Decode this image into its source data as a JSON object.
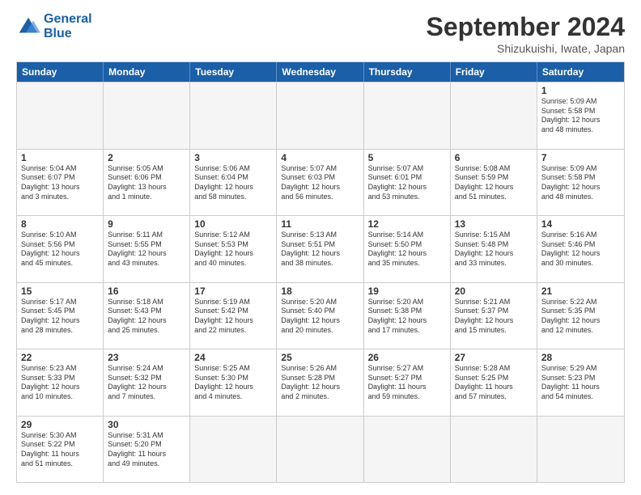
{
  "header": {
    "logo": {
      "line1": "General",
      "line2": "Blue"
    },
    "title": "September 2024",
    "location": "Shizukuishi, Iwate, Japan"
  },
  "weekdays": [
    "Sunday",
    "Monday",
    "Tuesday",
    "Wednesday",
    "Thursday",
    "Friday",
    "Saturday"
  ],
  "rows": [
    [
      {
        "day": "",
        "empty": true
      },
      {
        "day": "",
        "empty": true
      },
      {
        "day": "",
        "empty": true
      },
      {
        "day": "",
        "empty": true
      },
      {
        "day": "",
        "empty": true
      },
      {
        "day": "",
        "empty": true
      },
      {
        "day": "1",
        "lines": [
          "Sunrise: 5:09 AM",
          "Sunset: 5:58 PM",
          "Daylight: 12 hours",
          "and 48 minutes."
        ]
      }
    ],
    [
      {
        "day": "1",
        "lines": [
          "Sunrise: 5:04 AM",
          "Sunset: 6:07 PM",
          "Daylight: 13 hours",
          "and 3 minutes."
        ]
      },
      {
        "day": "2",
        "lines": [
          "Sunrise: 5:05 AM",
          "Sunset: 6:06 PM",
          "Daylight: 13 hours",
          "and 1 minute."
        ]
      },
      {
        "day": "3",
        "lines": [
          "Sunrise: 5:06 AM",
          "Sunset: 6:04 PM",
          "Daylight: 12 hours",
          "and 58 minutes."
        ]
      },
      {
        "day": "4",
        "lines": [
          "Sunrise: 5:07 AM",
          "Sunset: 6:03 PM",
          "Daylight: 12 hours",
          "and 56 minutes."
        ]
      },
      {
        "day": "5",
        "lines": [
          "Sunrise: 5:07 AM",
          "Sunset: 6:01 PM",
          "Daylight: 12 hours",
          "and 53 minutes."
        ]
      },
      {
        "day": "6",
        "lines": [
          "Sunrise: 5:08 AM",
          "Sunset: 5:59 PM",
          "Daylight: 12 hours",
          "and 51 minutes."
        ]
      },
      {
        "day": "7",
        "lines": [
          "Sunrise: 5:09 AM",
          "Sunset: 5:58 PM",
          "Daylight: 12 hours",
          "and 48 minutes."
        ]
      }
    ],
    [
      {
        "day": "8",
        "lines": [
          "Sunrise: 5:10 AM",
          "Sunset: 5:56 PM",
          "Daylight: 12 hours",
          "and 45 minutes."
        ]
      },
      {
        "day": "9",
        "lines": [
          "Sunrise: 5:11 AM",
          "Sunset: 5:55 PM",
          "Daylight: 12 hours",
          "and 43 minutes."
        ]
      },
      {
        "day": "10",
        "lines": [
          "Sunrise: 5:12 AM",
          "Sunset: 5:53 PM",
          "Daylight: 12 hours",
          "and 40 minutes."
        ]
      },
      {
        "day": "11",
        "lines": [
          "Sunrise: 5:13 AM",
          "Sunset: 5:51 PM",
          "Daylight: 12 hours",
          "and 38 minutes."
        ]
      },
      {
        "day": "12",
        "lines": [
          "Sunrise: 5:14 AM",
          "Sunset: 5:50 PM",
          "Daylight: 12 hours",
          "and 35 minutes."
        ]
      },
      {
        "day": "13",
        "lines": [
          "Sunrise: 5:15 AM",
          "Sunset: 5:48 PM",
          "Daylight: 12 hours",
          "and 33 minutes."
        ]
      },
      {
        "day": "14",
        "lines": [
          "Sunrise: 5:16 AM",
          "Sunset: 5:46 PM",
          "Daylight: 12 hours",
          "and 30 minutes."
        ]
      }
    ],
    [
      {
        "day": "15",
        "lines": [
          "Sunrise: 5:17 AM",
          "Sunset: 5:45 PM",
          "Daylight: 12 hours",
          "and 28 minutes."
        ]
      },
      {
        "day": "16",
        "lines": [
          "Sunrise: 5:18 AM",
          "Sunset: 5:43 PM",
          "Daylight: 12 hours",
          "and 25 minutes."
        ]
      },
      {
        "day": "17",
        "lines": [
          "Sunrise: 5:19 AM",
          "Sunset: 5:42 PM",
          "Daylight: 12 hours",
          "and 22 minutes."
        ]
      },
      {
        "day": "18",
        "lines": [
          "Sunrise: 5:20 AM",
          "Sunset: 5:40 PM",
          "Daylight: 12 hours",
          "and 20 minutes."
        ]
      },
      {
        "day": "19",
        "lines": [
          "Sunrise: 5:20 AM",
          "Sunset: 5:38 PM",
          "Daylight: 12 hours",
          "and 17 minutes."
        ]
      },
      {
        "day": "20",
        "lines": [
          "Sunrise: 5:21 AM",
          "Sunset: 5:37 PM",
          "Daylight: 12 hours",
          "and 15 minutes."
        ]
      },
      {
        "day": "21",
        "lines": [
          "Sunrise: 5:22 AM",
          "Sunset: 5:35 PM",
          "Daylight: 12 hours",
          "and 12 minutes."
        ]
      }
    ],
    [
      {
        "day": "22",
        "lines": [
          "Sunrise: 5:23 AM",
          "Sunset: 5:33 PM",
          "Daylight: 12 hours",
          "and 10 minutes."
        ]
      },
      {
        "day": "23",
        "lines": [
          "Sunrise: 5:24 AM",
          "Sunset: 5:32 PM",
          "Daylight: 12 hours",
          "and 7 minutes."
        ]
      },
      {
        "day": "24",
        "lines": [
          "Sunrise: 5:25 AM",
          "Sunset: 5:30 PM",
          "Daylight: 12 hours",
          "and 4 minutes."
        ]
      },
      {
        "day": "25",
        "lines": [
          "Sunrise: 5:26 AM",
          "Sunset: 5:28 PM",
          "Daylight: 12 hours",
          "and 2 minutes."
        ]
      },
      {
        "day": "26",
        "lines": [
          "Sunrise: 5:27 AM",
          "Sunset: 5:27 PM",
          "Daylight: 11 hours",
          "and 59 minutes."
        ]
      },
      {
        "day": "27",
        "lines": [
          "Sunrise: 5:28 AM",
          "Sunset: 5:25 PM",
          "Daylight: 11 hours",
          "and 57 minutes."
        ]
      },
      {
        "day": "28",
        "lines": [
          "Sunrise: 5:29 AM",
          "Sunset: 5:23 PM",
          "Daylight: 11 hours",
          "and 54 minutes."
        ]
      }
    ],
    [
      {
        "day": "29",
        "lines": [
          "Sunrise: 5:30 AM",
          "Sunset: 5:22 PM",
          "Daylight: 11 hours",
          "and 51 minutes."
        ]
      },
      {
        "day": "30",
        "lines": [
          "Sunrise: 5:31 AM",
          "Sunset: 5:20 PM",
          "Daylight: 11 hours",
          "and 49 minutes."
        ]
      },
      {
        "day": "",
        "empty": true
      },
      {
        "day": "",
        "empty": true
      },
      {
        "day": "",
        "empty": true
      },
      {
        "day": "",
        "empty": true
      },
      {
        "day": "",
        "empty": true
      }
    ]
  ]
}
